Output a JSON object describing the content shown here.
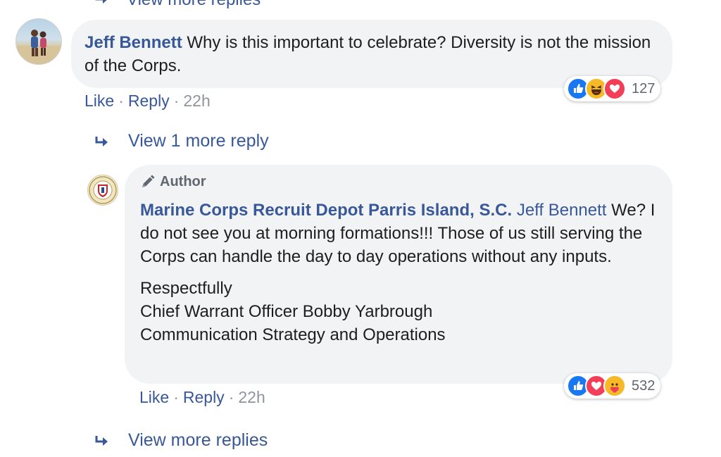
{
  "top_partial": {
    "label": "View more replies"
  },
  "comment_1": {
    "author": "Jeff Bennett",
    "text": "Why is this important to celebrate? Diversity is not the mission of the Corps.",
    "actions": {
      "like": "Like",
      "reply": "Reply",
      "time": "22h",
      "sep": "·"
    },
    "reactions": {
      "icons": [
        "like-icon",
        "haha-icon",
        "love-icon"
      ],
      "count": "127"
    }
  },
  "view_1_more_reply": {
    "label": "View 1 more reply"
  },
  "comment_2": {
    "badge": "Author",
    "author": "Marine Corps Recruit Depot Parris Island, S.C.",
    "mention": "Jeff Bennett",
    "paragraph_1": "We? I do not see you at morning formations!!! Those of us still serving the Corps can handle the day to day operations without any inputs.",
    "paragraph_2_lines": [
      "Respectfully",
      "Chief Warrant Officer Bobby Yarbrough",
      "Communication Strategy and Operations"
    ],
    "actions": {
      "like": "Like",
      "reply": "Reply",
      "time": "22h",
      "sep": "·"
    },
    "reactions": {
      "icons": [
        "like-icon",
        "love-icon",
        "care-icon"
      ],
      "count": "532"
    }
  },
  "view_more_replies": {
    "label": "View more replies"
  },
  "colors": {
    "link": "#385898",
    "bubble": "#f2f3f5",
    "muted": "#90949c",
    "like_blue": "#1877f2",
    "love_red": "#f33e58",
    "haha_yellow": "#f7b928"
  }
}
